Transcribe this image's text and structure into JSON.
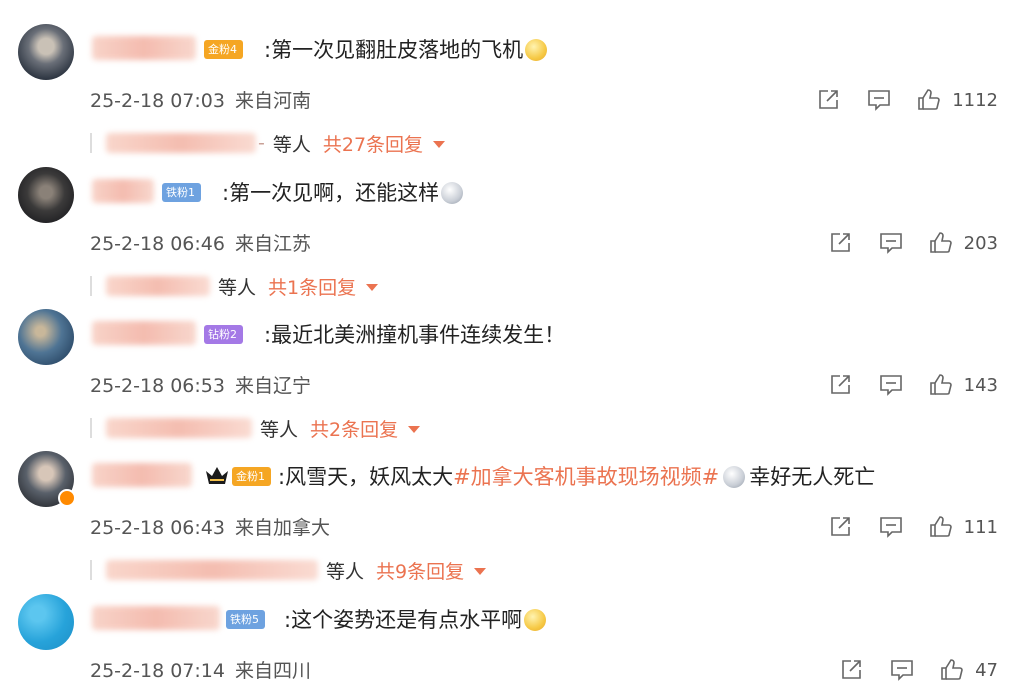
{
  "comments": [
    {
      "name": "汉族小猪哥",
      "badge": {
        "label": "金粉4",
        "kind": "gold"
      },
      "text": ":第一次见翻肚皮落地的飞机",
      "emoji": "yellow",
      "timestamp": "25-2-18 07:03",
      "location": "来自河南",
      "likes": "1112",
      "reply_name": "坤坤在哪看啥呢",
      "reply_dash": "-",
      "reply_etal": "等人",
      "reply_count": "共27条回复"
    },
    {
      "name": "网友小号",
      "badge": {
        "label": "铁粉1",
        "kind": "iron"
      },
      "text": ":第一次见啊，还能这样",
      "emoji": "gray",
      "timestamp": "25-2-18 06:46",
      "location": "来自江苏",
      "likes": "203",
      "reply_name": "来回回来聊聊",
      "reply_dash": "",
      "reply_etal": "等人",
      "reply_count": "共1条回复"
    },
    {
      "name": "长桥小锁链",
      "badge": {
        "label": "钻粉2",
        "kind": "diamond"
      },
      "text": ":最近北美洲撞机事件连续发生！",
      "emoji": "",
      "timestamp": "25-2-18 06:53",
      "location": "来自辽宁",
      "likes": "143",
      "reply_name": "天天一只羊羊不做",
      "reply_dash": "",
      "reply_etal": "等人",
      "reply_count": "共2条回复"
    },
    {
      "name": "当今世界是新",
      "badge": {
        "label": "金粉1",
        "kind": "gold"
      },
      "text_prefix": ":风雪天，妖风太大",
      "text_tag": "#加拿大客机事故现场视频#",
      "text_suffix": "幸好无人死亡",
      "emoji": "gray",
      "timestamp": "25-2-18 06:43",
      "location": "来自加拿大",
      "likes": "111",
      "reply_name": "文博明明ladyRayant",
      "reply_dash": "",
      "reply_etal": "等人",
      "reply_count": "共9条回复"
    },
    {
      "name": "满满的兔子卡卡",
      "badge": {
        "label": "铁粉5",
        "kind": "iron"
      },
      "text": ":这个姿势还是有点水平啊",
      "emoji": "yellow",
      "timestamp": "25-2-18 07:14",
      "location": "来自四川",
      "likes": "47"
    }
  ]
}
